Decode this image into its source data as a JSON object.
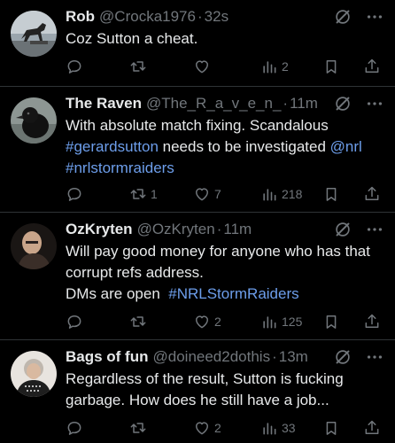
{
  "tweets": [
    {
      "name": "Rob",
      "handle": "@Crocka1976",
      "time": "32s",
      "lines": [
        "Coz Sutton a cheat."
      ],
      "metrics": {
        "replies": "",
        "retweets": "",
        "likes": "",
        "views": "2"
      },
      "avatar_icon": "horse-statue-avatar"
    },
    {
      "name": "The Raven",
      "handle": "@The_R_a_v_e_n_",
      "time": "11m",
      "line1": "With absolute match fixing. Scandalous",
      "hashtag1": "#gerardsutton",
      "line2_text": " needs to be investigated ",
      "mention": "@nrl",
      "hashtag2": "#nrlstormraiders",
      "metrics": {
        "replies": "",
        "retweets": "1",
        "likes": "7",
        "views": "218"
      },
      "avatar_icon": "raven-avatar"
    },
    {
      "name": "OzKryten",
      "handle": "@OzKryten",
      "time": "11m",
      "line1": "Will pay good money for anyone who has that",
      "line2": "corrupt refs address.",
      "line3_text": "DMs are open  ",
      "hashtag": "#NRLStormRaiders",
      "metrics": {
        "replies": "",
        "retweets": "",
        "likes": "2",
        "views": "125"
      },
      "avatar_icon": "man-portrait-avatar"
    },
    {
      "name": "Bags of fun",
      "handle": "@doineed2dothis",
      "time": "13m",
      "line1": "Regardless of the result, Sutton is fucking",
      "line2": "garbage. How does he still have a job...",
      "metrics": {
        "replies": "",
        "retweets": "",
        "likes": "2",
        "views": "33"
      },
      "avatar_icon": "woman-portrait-avatar"
    }
  ],
  "separator": "·",
  "colors": {
    "background": "#000000",
    "text": "#e7e9ea",
    "muted": "#71767b",
    "link": "#6d9eeb",
    "divider": "#2f3336"
  }
}
